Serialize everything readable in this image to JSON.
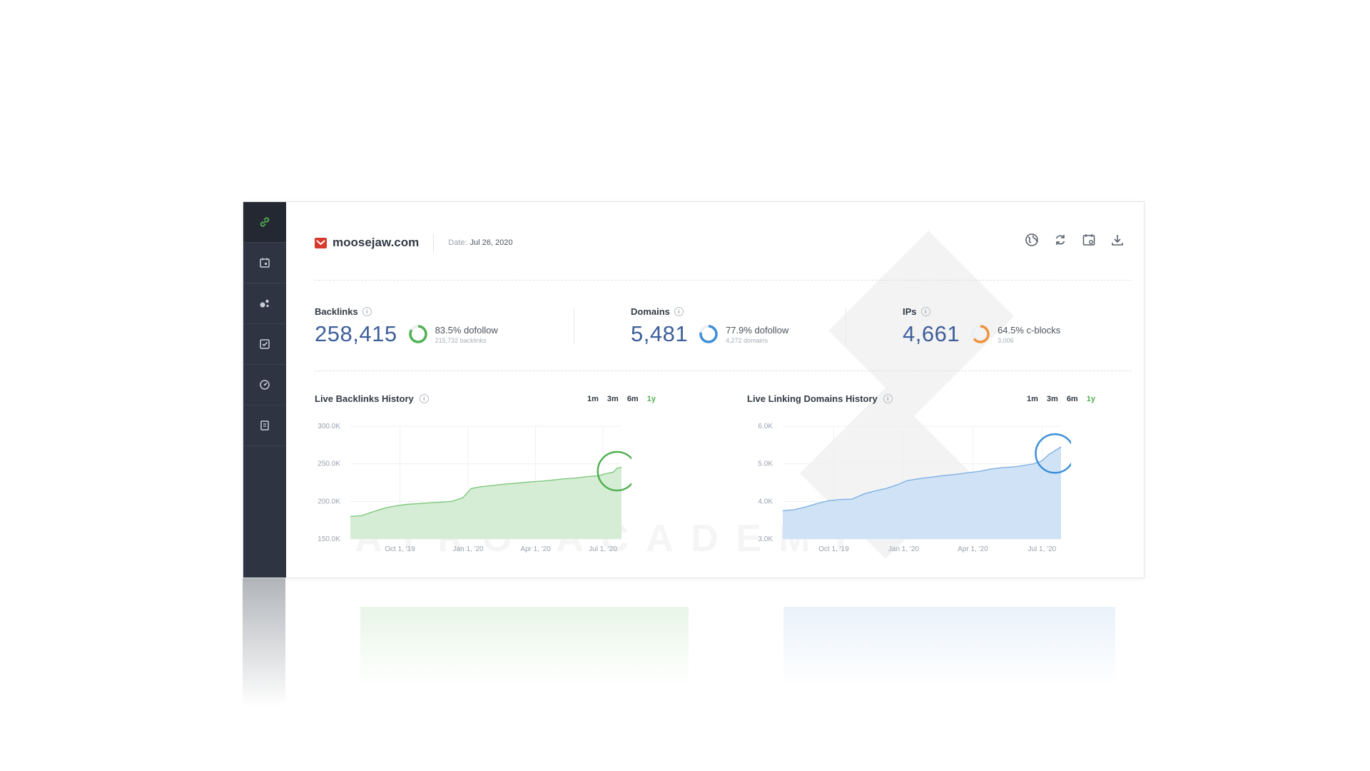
{
  "site": {
    "name": "moosejaw.com",
    "date_label": "Date:",
    "date_value": "Jul 26, 2020"
  },
  "sidebar": {
    "items": [
      {
        "icon": "link-icon",
        "active": true
      },
      {
        "icon": "calendar-icon"
      },
      {
        "icon": "network-icon"
      },
      {
        "icon": "checklist-icon"
      },
      {
        "icon": "gauge-icon"
      },
      {
        "icon": "document-icon"
      }
    ]
  },
  "toolbar": {
    "icons": [
      "globe-icon",
      "refresh-icon",
      "calendar-icon",
      "download-icon"
    ]
  },
  "stats": [
    {
      "label": "Backlinks",
      "value": "258,415",
      "percent_text": "83.5% dofollow",
      "small": "215,732 backlinks",
      "fraction": 0.835,
      "color": "#52b153"
    },
    {
      "label": "Domains",
      "value": "5,481",
      "percent_text": "77.9% dofollow",
      "small": "4,272 domains",
      "fraction": 0.779,
      "color": "#3d8fd8"
    },
    {
      "label": "IPs",
      "value": "4,661",
      "percent_text": "64.5% c-blocks",
      "small": "3,006",
      "fraction": 0.645,
      "color": "#f0923a"
    }
  ],
  "charts": {
    "backlinks": {
      "title": "Live Backlinks History",
      "ranges": [
        "1m",
        "3m",
        "6m",
        "1y"
      ],
      "selected": "1y"
    },
    "domains": {
      "title": "Live Linking Domains History",
      "ranges": [
        "1m",
        "3m",
        "6m",
        "1y"
      ],
      "selected": "1y"
    }
  },
  "colors": {
    "sidebar": "#2e3442",
    "value_blue": "#3e5f9b",
    "green_fill": "#d6edd5",
    "green_line": "#7fc97e",
    "blue_fill": "#d0e2f5",
    "blue_line": "#7fb1e3",
    "accent_green": "#52b153"
  },
  "watermark": {
    "text": "ATRO ACADEMY"
  },
  "chart_data": [
    {
      "type": "area",
      "title": "Live Backlinks History",
      "x_ticks": [
        "Oct 1, '19",
        "Jan 1, '20",
        "Apr 1, '20",
        "Jul 1, '20"
      ],
      "y_ticks": [
        "150.0K",
        "200.0K",
        "250.0K",
        "300.0K"
      ],
      "ylim": [
        150000,
        300000
      ],
      "grid": true,
      "x": [
        "2019-07-26",
        "2019-08-10",
        "2019-08-25",
        "2019-09-10",
        "2019-09-25",
        "2019-10-10",
        "2019-10-25",
        "2019-11-10",
        "2019-11-25",
        "2019-12-10",
        "2019-12-25",
        "2020-01-05",
        "2020-01-15",
        "2020-02-01",
        "2020-02-20",
        "2020-03-10",
        "2020-03-25",
        "2020-04-10",
        "2020-04-25",
        "2020-05-10",
        "2020-05-25",
        "2020-06-10",
        "2020-06-25",
        "2020-07-05",
        "2020-07-15",
        "2020-07-20",
        "2020-07-26"
      ],
      "values": [
        180000,
        181000,
        186000,
        191000,
        194000,
        196000,
        197000,
        198000,
        199000,
        200000,
        205000,
        217000,
        219000,
        221000,
        223000,
        224500,
        226000,
        227000,
        228500,
        230000,
        231000,
        233000,
        234000,
        237000,
        239000,
        244000,
        245500
      ],
      "highlight": "2020-07-20"
    },
    {
      "type": "area",
      "title": "Live Linking Domains History",
      "x_ticks": [
        "Oct 1, '19",
        "Jan 1, '20",
        "Apr 1, '20",
        "Jul 1, '20"
      ],
      "y_ticks": [
        "3.0K",
        "4.0K",
        "5.0K",
        "6.0K"
      ],
      "ylim": [
        3000,
        6000
      ],
      "grid": true,
      "x": [
        "2019-07-26",
        "2019-08-10",
        "2019-08-25",
        "2019-09-10",
        "2019-09-25",
        "2019-10-10",
        "2019-10-25",
        "2019-11-10",
        "2019-11-25",
        "2019-12-10",
        "2019-12-25",
        "2020-01-05",
        "2020-01-20",
        "2020-02-05",
        "2020-02-20",
        "2020-03-10",
        "2020-03-25",
        "2020-04-10",
        "2020-04-25",
        "2020-05-10",
        "2020-05-25",
        "2020-06-05",
        "2020-06-20",
        "2020-07-01",
        "2020-07-10",
        "2020-07-18",
        "2020-07-26"
      ],
      "values": [
        3750,
        3780,
        3850,
        3950,
        4020,
        4050,
        4060,
        4200,
        4280,
        4350,
        4450,
        4550,
        4600,
        4640,
        4680,
        4720,
        4760,
        4800,
        4860,
        4900,
        4920,
        4950,
        5000,
        5080,
        5250,
        5350,
        5450
      ],
      "highlight": "2020-07-18"
    }
  ]
}
